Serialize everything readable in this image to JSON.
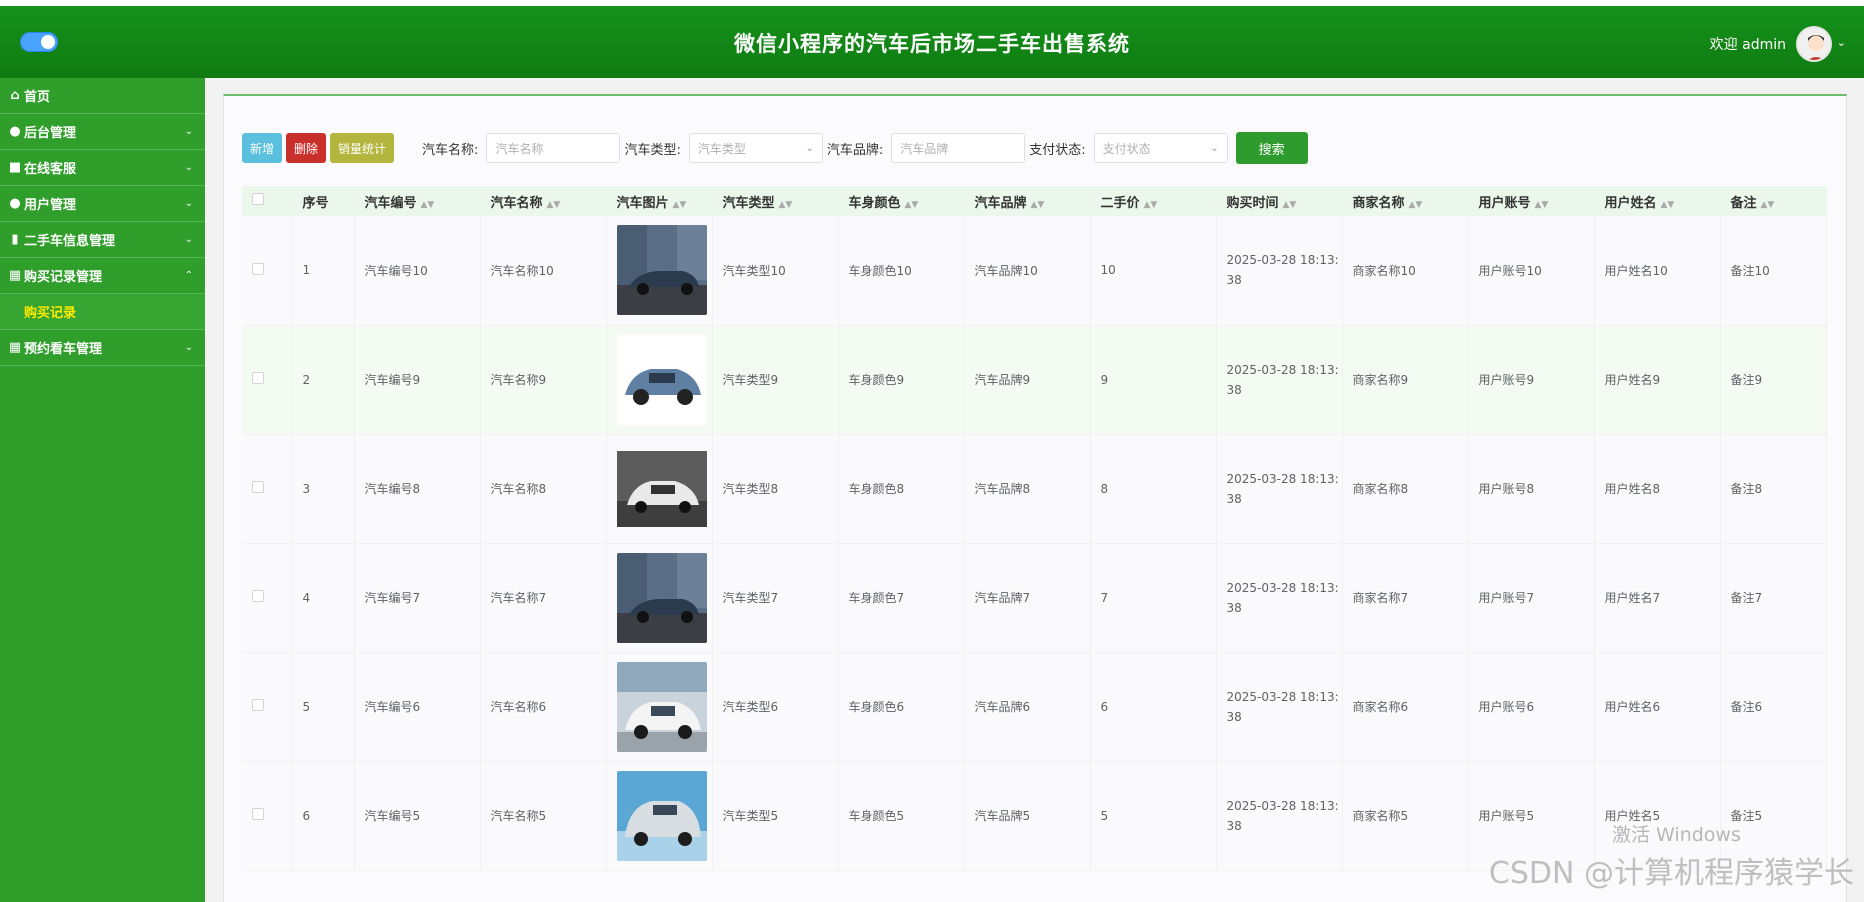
{
  "header": {
    "title": "微信小程序的汽车后市场二手车出售系统",
    "welcome": "欢迎 admin"
  },
  "sidebar": {
    "items": [
      {
        "label": "首页",
        "icon": "home-icon"
      },
      {
        "label": "后台管理",
        "icon": "circle-icon"
      },
      {
        "label": "在线客服",
        "icon": "chat-icon"
      },
      {
        "label": "用户管理",
        "icon": "user-icon"
      },
      {
        "label": "二手车信息管理",
        "icon": "doc-icon"
      },
      {
        "label": "购买记录管理",
        "icon": "grid-icon"
      },
      {
        "label": "预约看车管理",
        "icon": "grid-icon"
      }
    ],
    "submenu_active": "购买记录"
  },
  "toolbar": {
    "add_label": "新增",
    "delete_label": "删除",
    "stats_label": "销量统计",
    "search_label": "搜索"
  },
  "filters": {
    "name_label": "汽车名称:",
    "name_placeholder": "汽车名称",
    "type_label": "汽车类型:",
    "type_placeholder": "汽车类型",
    "brand_label": "汽车品牌:",
    "brand_placeholder": "汽车品牌",
    "pay_label": "支付状态:",
    "pay_placeholder": "支付状态"
  },
  "table": {
    "headers": [
      "序号",
      "汽车编号",
      "汽车名称",
      "汽车图片",
      "汽车类型",
      "车身颜色",
      "汽车品牌",
      "二手价",
      "购买时间",
      "商家名称",
      "用户账号",
      "用户姓名",
      "备注"
    ],
    "rows": [
      {
        "no": "1",
        "code": "汽车编号10",
        "name": "汽车名称10",
        "type": "汽车类型10",
        "color": "车身颜色10",
        "brand": "汽车品牌10",
        "price": "10",
        "time1": "2025-03-28 18:13:",
        "time2": "38",
        "merchant": "商家名称10",
        "account": "用户账号10",
        "username": "用户姓名10",
        "remark": "备注10"
      },
      {
        "no": "2",
        "code": "汽车编号9",
        "name": "汽车名称9",
        "type": "汽车类型9",
        "color": "车身颜色9",
        "brand": "汽车品牌9",
        "price": "9",
        "time1": "2025-03-28 18:13:",
        "time2": "38",
        "merchant": "商家名称9",
        "account": "用户账号9",
        "username": "用户姓名9",
        "remark": "备注9"
      },
      {
        "no": "3",
        "code": "汽车编号8",
        "name": "汽车名称8",
        "type": "汽车类型8",
        "color": "车身颜色8",
        "brand": "汽车品牌8",
        "price": "8",
        "time1": "2025-03-28 18:13:",
        "time2": "38",
        "merchant": "商家名称8",
        "account": "用户账号8",
        "username": "用户姓名8",
        "remark": "备注8"
      },
      {
        "no": "4",
        "code": "汽车编号7",
        "name": "汽车名称7",
        "type": "汽车类型7",
        "color": "车身颜色7",
        "brand": "汽车品牌7",
        "price": "7",
        "time1": "2025-03-28 18:13:",
        "time2": "38",
        "merchant": "商家名称7",
        "account": "用户账号7",
        "username": "用户姓名7",
        "remark": "备注7"
      },
      {
        "no": "5",
        "code": "汽车编号6",
        "name": "汽车名称6",
        "type": "汽车类型6",
        "color": "车身颜色6",
        "brand": "汽车品牌6",
        "price": "6",
        "time1": "2025-03-28 18:13:",
        "time2": "38",
        "merchant": "商家名称6",
        "account": "用户账号6",
        "username": "用户姓名6",
        "remark": "备注6"
      },
      {
        "no": "6",
        "code": "汽车编号5",
        "name": "汽车名称5",
        "type": "汽车类型5",
        "color": "车身颜色5",
        "brand": "汽车品牌5",
        "price": "5",
        "time1": "2025-03-28 18:13:",
        "time2": "38",
        "merchant": "商家名称5",
        "account": "用户账号5",
        "username": "用户姓名5",
        "remark": "备注5"
      }
    ]
  },
  "overlays": {
    "windows_activate": "激活 Windows",
    "csdn_watermark": "CSDN @计算机程序猿学长"
  },
  "colors": {
    "header_green": "#15921a",
    "sidebar_green": "#2f9e2a",
    "submenu_active_text": "#ffe900",
    "btn_add": "#5bc0de",
    "btn_delete": "#c9302c",
    "btn_stats": "#b3b53d",
    "btn_search": "#2d9b2d"
  }
}
